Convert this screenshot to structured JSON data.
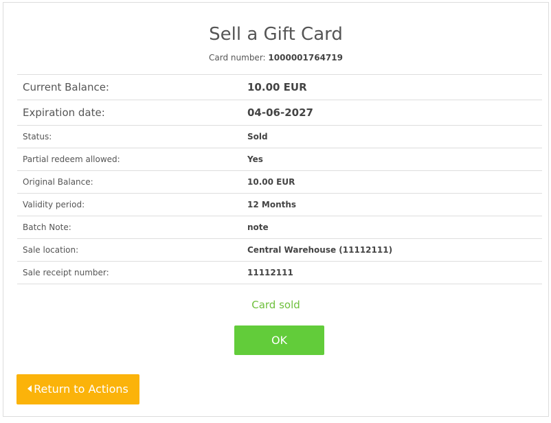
{
  "header": {
    "title": "Sell a Gift Card",
    "card_number_label": "Card number:",
    "card_number_value": "1000001764719"
  },
  "details": [
    {
      "label": "Current Balance:",
      "value": "10.00 EUR"
    },
    {
      "label": "Expiration date:",
      "value": "04-06-2027"
    },
    {
      "label": "Status:",
      "value": "Sold"
    },
    {
      "label": "Partial redeem allowed:",
      "value": "Yes"
    },
    {
      "label": "Original Balance:",
      "value": "10.00 EUR"
    },
    {
      "label": "Validity period:",
      "value": "12 Months"
    },
    {
      "label": "Batch Note:",
      "value": "note"
    },
    {
      "label": "Sale location:",
      "value": "Central Warehouse (11112111)"
    },
    {
      "label": "Sale receipt number:",
      "value": "11112111"
    }
  ],
  "status_message": "Card sold",
  "actions": {
    "ok_label": "OK",
    "return_label": "Return to Actions",
    "return_icon": "caret-left-icon"
  },
  "colors": {
    "success_text": "#6dbf3a",
    "ok_button": "#62cc3a",
    "return_button": "#fbb30a"
  }
}
